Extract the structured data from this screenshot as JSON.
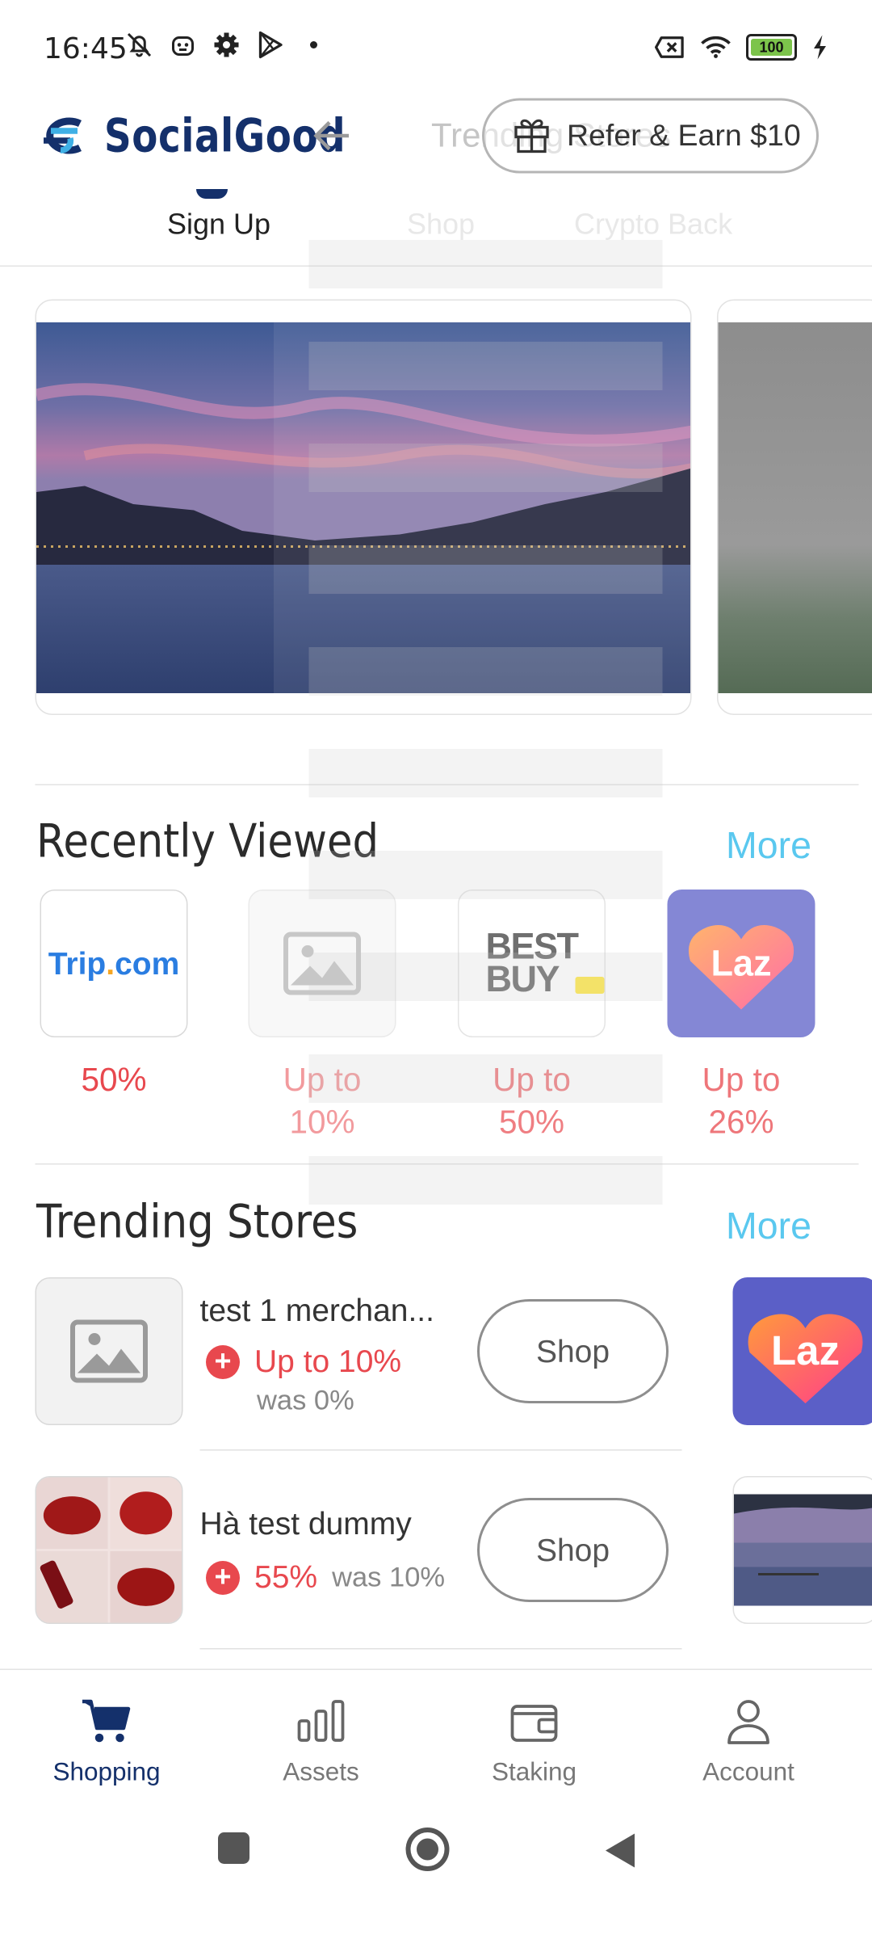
{
  "status_bar": {
    "time": "16:45",
    "battery_level": "100"
  },
  "header": {
    "brand": "SocialGood",
    "ghost_title": "Trending Stores",
    "refer_button": "Refer & Earn $10"
  },
  "tabs": [
    {
      "label": "Sign Up",
      "active": true
    },
    {
      "label": "Shop",
      "active": false
    },
    {
      "label": "Crypto Back",
      "active": false
    }
  ],
  "recently_viewed": {
    "title": "Recently Viewed",
    "more": "More",
    "items": [
      {
        "logo": "Trip.com",
        "pct_line1": "50%",
        "pct_line2": ""
      },
      {
        "logo": "placeholder-image-icon",
        "pct_line1": "Up to",
        "pct_line2": "10%"
      },
      {
        "logo": "BEST BUY",
        "pct_line1": "Up to",
        "pct_line2": "50%"
      },
      {
        "logo": "Laz",
        "pct_line1": "Up to",
        "pct_line2": "26%"
      }
    ]
  },
  "trending": {
    "title": "Trending Stores",
    "more": "More",
    "stores": [
      {
        "name": "test 1 merchan...",
        "offer": "Up to 10%",
        "was": "was 0%",
        "shop": "Shop"
      },
      {
        "name": "Hà test dummy",
        "offer": "55%",
        "was": "was 10%",
        "shop": "Shop"
      }
    ],
    "side_logo": "Laz"
  },
  "bottom_nav": [
    {
      "label": "Shopping",
      "icon": "cart-icon",
      "active": true
    },
    {
      "label": "Assets",
      "icon": "bar-chart-icon",
      "active": false
    },
    {
      "label": "Staking",
      "icon": "wallet-icon",
      "active": false
    },
    {
      "label": "Account",
      "icon": "person-icon",
      "active": false
    }
  ],
  "colors": {
    "brand_navy": "#14306b",
    "accent_red": "#e8484e",
    "link_blue": "#5ac8ef",
    "lazada_purple": "#5b5fc7"
  }
}
